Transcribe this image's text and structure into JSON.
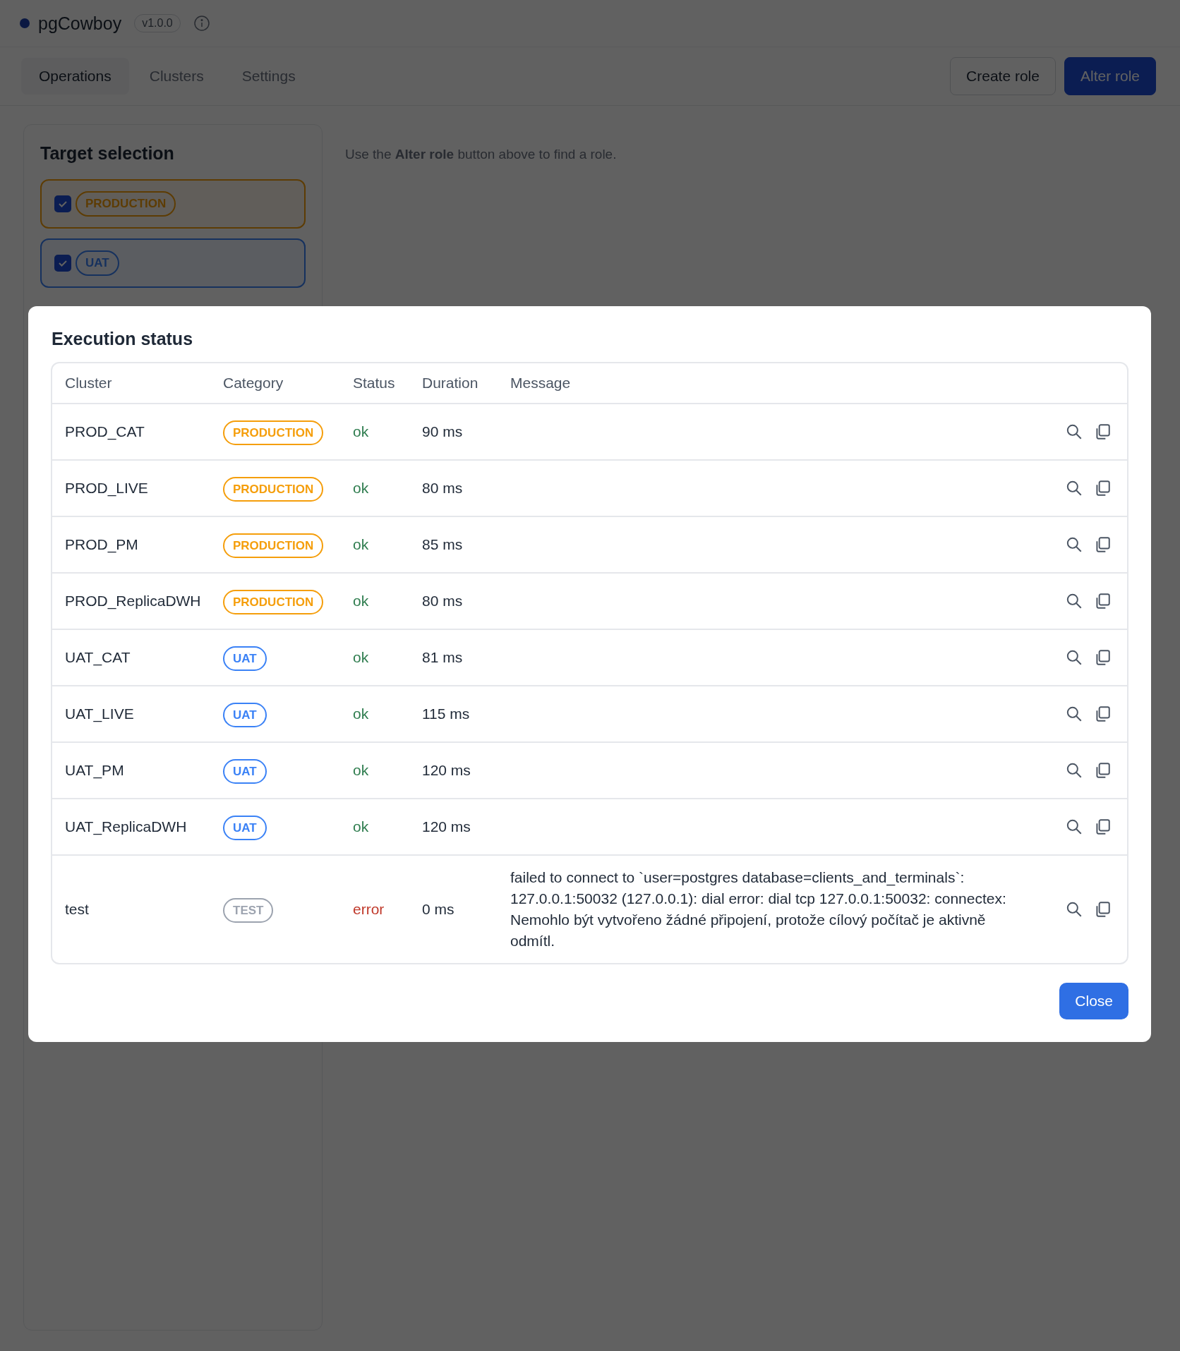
{
  "app": {
    "name": "pgCowboy",
    "version": "v1.0.0"
  },
  "tabs": [
    {
      "label": "Operations",
      "selected": true
    },
    {
      "label": "Clusters",
      "selected": false
    },
    {
      "label": "Settings",
      "selected": false
    }
  ],
  "actions": [
    {
      "label": "Create role",
      "kind": "secondary"
    },
    {
      "label": "Alter role",
      "kind": "primary"
    }
  ],
  "sidebar": {
    "title": "Target selection",
    "targets": [
      {
        "label": "PRODUCTION",
        "checked": true,
        "kind": "production"
      },
      {
        "label": "UAT",
        "checked": true,
        "kind": "uat"
      }
    ]
  },
  "hint": "Use the **Alter role** button above to find a role.",
  "dialog": {
    "title": "Execution status",
    "columns": [
      "Cluster",
      "Category",
      "Status",
      "Duration",
      "Message"
    ],
    "rows": [
      {
        "cluster": "PROD_CAT",
        "category": "PRODUCTION",
        "color": "#f59e0b",
        "status": "ok",
        "kind": "ok",
        "duration": "90 ms"
      },
      {
        "cluster": "PROD_LIVE",
        "category": "PRODUCTION",
        "color": "#f59e0b",
        "status": "ok",
        "kind": "ok",
        "duration": "80 ms"
      },
      {
        "cluster": "PROD_PM",
        "category": "PRODUCTION",
        "color": "#f59e0b",
        "status": "ok",
        "kind": "ok",
        "duration": "85 ms"
      },
      {
        "cluster": "PROD_ReplicaDWH",
        "category": "PRODUCTION",
        "color": "#f59e0b",
        "status": "ok",
        "kind": "ok",
        "duration": "80 ms"
      },
      {
        "cluster": "UAT_CAT",
        "category": "UAT",
        "color": "#3b82f6",
        "status": "ok",
        "kind": "ok",
        "duration": "81 ms"
      },
      {
        "cluster": "UAT_LIVE",
        "category": "UAT",
        "color": "#3b82f6",
        "status": "ok",
        "kind": "ok",
        "duration": "115 ms"
      },
      {
        "cluster": "UAT_PM",
        "category": "UAT",
        "color": "#3b82f6",
        "status": "ok",
        "kind": "ok",
        "duration": "120 ms"
      },
      {
        "cluster": "UAT_ReplicaDWH",
        "category": "UAT",
        "color": "#3b82f6",
        "status": "ok",
        "kind": "ok",
        "duration": "120 ms"
      },
      {
        "cluster": "test",
        "category": "TEST",
        "color": "#9ca3af",
        "status": "error",
        "kind": "error",
        "duration": "0 ms",
        "message": "failed to connect to `user=postgres database=clients_and_terminals`: 127.0.0.1:50032 (127.0.0.1): dial error: dial tcp 127.0.0.1:50032: connectex: Nemohlo být vytvořeno žádné připojení, protože cílový počítač je aktivně odmítl."
      }
    ],
    "close": "Close"
  }
}
